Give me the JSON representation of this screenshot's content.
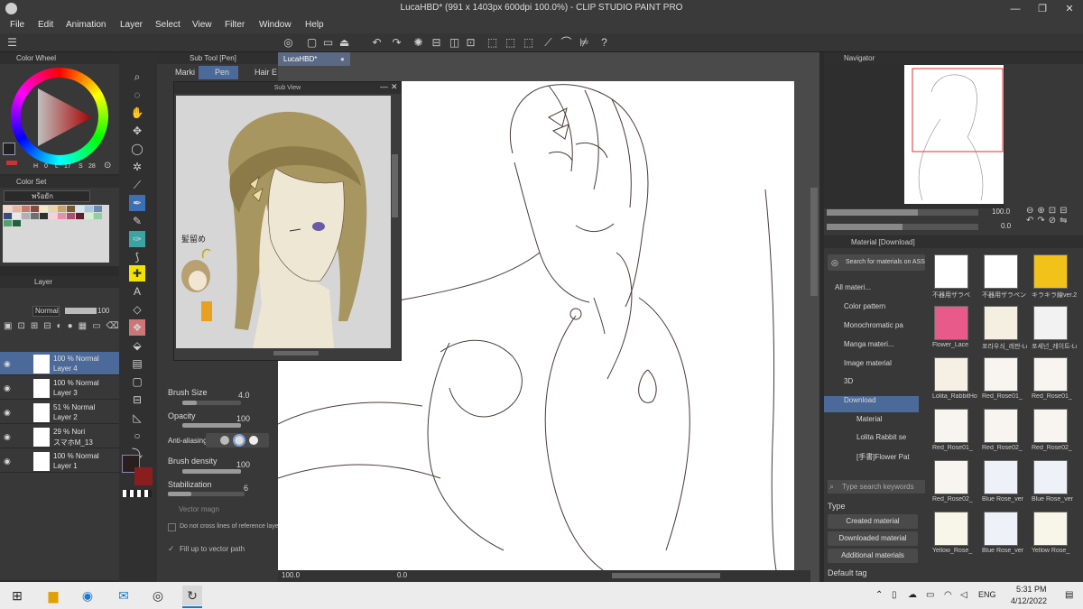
{
  "window": {
    "title": "LucaHBD* (991 x 1403px 600dpi 100.0%)  - CLIP STUDIO PAINT PRO",
    "minimize": "—",
    "maximize": "❐",
    "close": "✕"
  },
  "menu": [
    "File",
    "Edit",
    "Animation",
    "Layer",
    "Select",
    "View",
    "Filter",
    "Window",
    "Help"
  ],
  "panels": {
    "color_wheel": "Color Wheel",
    "color_wheel_values": {
      "h_label": "H",
      "h": "0",
      "l_label": "L",
      "l": "17",
      "s_label": "S",
      "s": "28"
    },
    "color_set": "Color Set",
    "color_set_name": "พร้อยัก",
    "layer": "Layer",
    "blend_mode": "Normal",
    "layer_opacity": "100",
    "sub_tool_title": "Sub Tool [Pen]",
    "sub_tool_tabs": [
      "Marki",
      "Pen",
      "Hair E"
    ],
    "sub_view": "Sub View",
    "navigator": "Navigator",
    "material": "Material [Download]",
    "canvas_tab": "LucaHBD*"
  },
  "layers": [
    {
      "line1": "100 % Normal",
      "line2": "Layer 4",
      "selected": true
    },
    {
      "line1": "100 % Normal",
      "line2": "Layer 3",
      "selected": false
    },
    {
      "line1": "51 % Normal",
      "line2": "Layer 2",
      "selected": false
    },
    {
      "line1": "29 % Nori",
      "line2": "スマホM_13",
      "selected": false
    },
    {
      "line1": "100 % Normal",
      "line2": "Layer 1",
      "selected": false
    }
  ],
  "tool_property": {
    "brush_size_label": "Brush Size",
    "brush_size": "4.0",
    "brush_size_fraction": 0.25,
    "opacity_label": "Opacity",
    "opacity": "100",
    "antialiasing_label": "Anti-aliasing",
    "brush_density_label": "Brush density",
    "brush_density": "100",
    "stabilization_label": "Stabilization",
    "stabilization": "6",
    "stabilization_fraction": 0.3,
    "vector_magnet_label": "Vector magn",
    "no_cross_label": "Do not cross lines of reference laye",
    "fill_vector_label": "Fill up to vector path"
  },
  "navigator": {
    "zoom": "100.0",
    "rotation": "0.0"
  },
  "canvas_status": {
    "zoom": "100.0",
    "rotation": "0.0"
  },
  "material": {
    "search_placeholder": "Search for materials on ASSETS",
    "tree": [
      "All materi...",
      "Color pattern",
      "Monochromatic pa",
      "Manga materi...",
      "Image material",
      "3D",
      "Download",
      "Material",
      "Lolita Rabbit se",
      "[手書]Flower Pat"
    ],
    "keyword_placeholder": "Type search keywords",
    "type_label": "Type",
    "type_buttons": [
      "Created material",
      "Downloaded material",
      "Additional materials"
    ],
    "default_tag": "Default tag",
    "items": [
      {
        "label": "不器用ザラペ",
        "color": "#ffffff"
      },
      {
        "label": "不器用ザラペン",
        "color": "#ffffff"
      },
      {
        "label": "キラキラ線ver.2",
        "color": "#f2c21b"
      },
      {
        "label": "Flower_Lace",
        "color": "#e85a8a"
      },
      {
        "label": "포라우싀_레판-Lol",
        "color": "#f4efe0"
      },
      {
        "label": "포세넌_레이트-Lo",
        "color": "#f2f2f2"
      },
      {
        "label": "Lolita_RabbitHo",
        "color": "#f6efe4"
      },
      {
        "label": "Red_Rose01_",
        "color": "#f8f4f0"
      },
      {
        "label": "Red_Rose01_",
        "color": "#f8f4f0"
      },
      {
        "label": "Red_Rose01_",
        "color": "#f8f4f0"
      },
      {
        "label": "Red_Rose02_",
        "color": "#f8f4f0"
      },
      {
        "label": "Red_Rose02_",
        "color": "#f8f4f0"
      },
      {
        "label": "Red_Rose02_",
        "color": "#f8f4f0"
      },
      {
        "label": "Blue Rose_ver",
        "color": "#eef2f8"
      },
      {
        "label": "Blue Rose_ver",
        "color": "#eef2f8"
      },
      {
        "label": "Yellow_Rose_",
        "color": "#f8f6e8"
      },
      {
        "label": "Blue Rose_ver",
        "color": "#eef2f8"
      },
      {
        "label": "Yellow Rose_",
        "color": "#f8f6e8"
      }
    ]
  },
  "sub_view_labels": {
    "pin_text": "髪留め"
  },
  "taskbar": {
    "time": "5:31 PM",
    "date": "4/12/2022",
    "language": "ENG"
  },
  "colors": {
    "main_color": "#2a1e1e",
    "sub_color": "#8a1e1e",
    "accent": "#3d6fb4",
    "canvas_bg": "#ffffff"
  },
  "swatches": [
    "#f2d6c8",
    "#e8b4a0",
    "#c97a6a",
    "#8c4a3e",
    "#f7e8c8",
    "#ecd6a2",
    "#c8a46a",
    "#7a5a30",
    "#d8e8f0",
    "#a8c8e0",
    "#6a8ab4",
    "#3a4a7a",
    "#e8e8e8",
    "#b0b0b0",
    "#707070",
    "#303030",
    "#f8d0d8",
    "#e890a8",
    "#b05070",
    "#602030",
    "#d0f0d0",
    "#90d0a0",
    "#50a070",
    "#206040"
  ]
}
